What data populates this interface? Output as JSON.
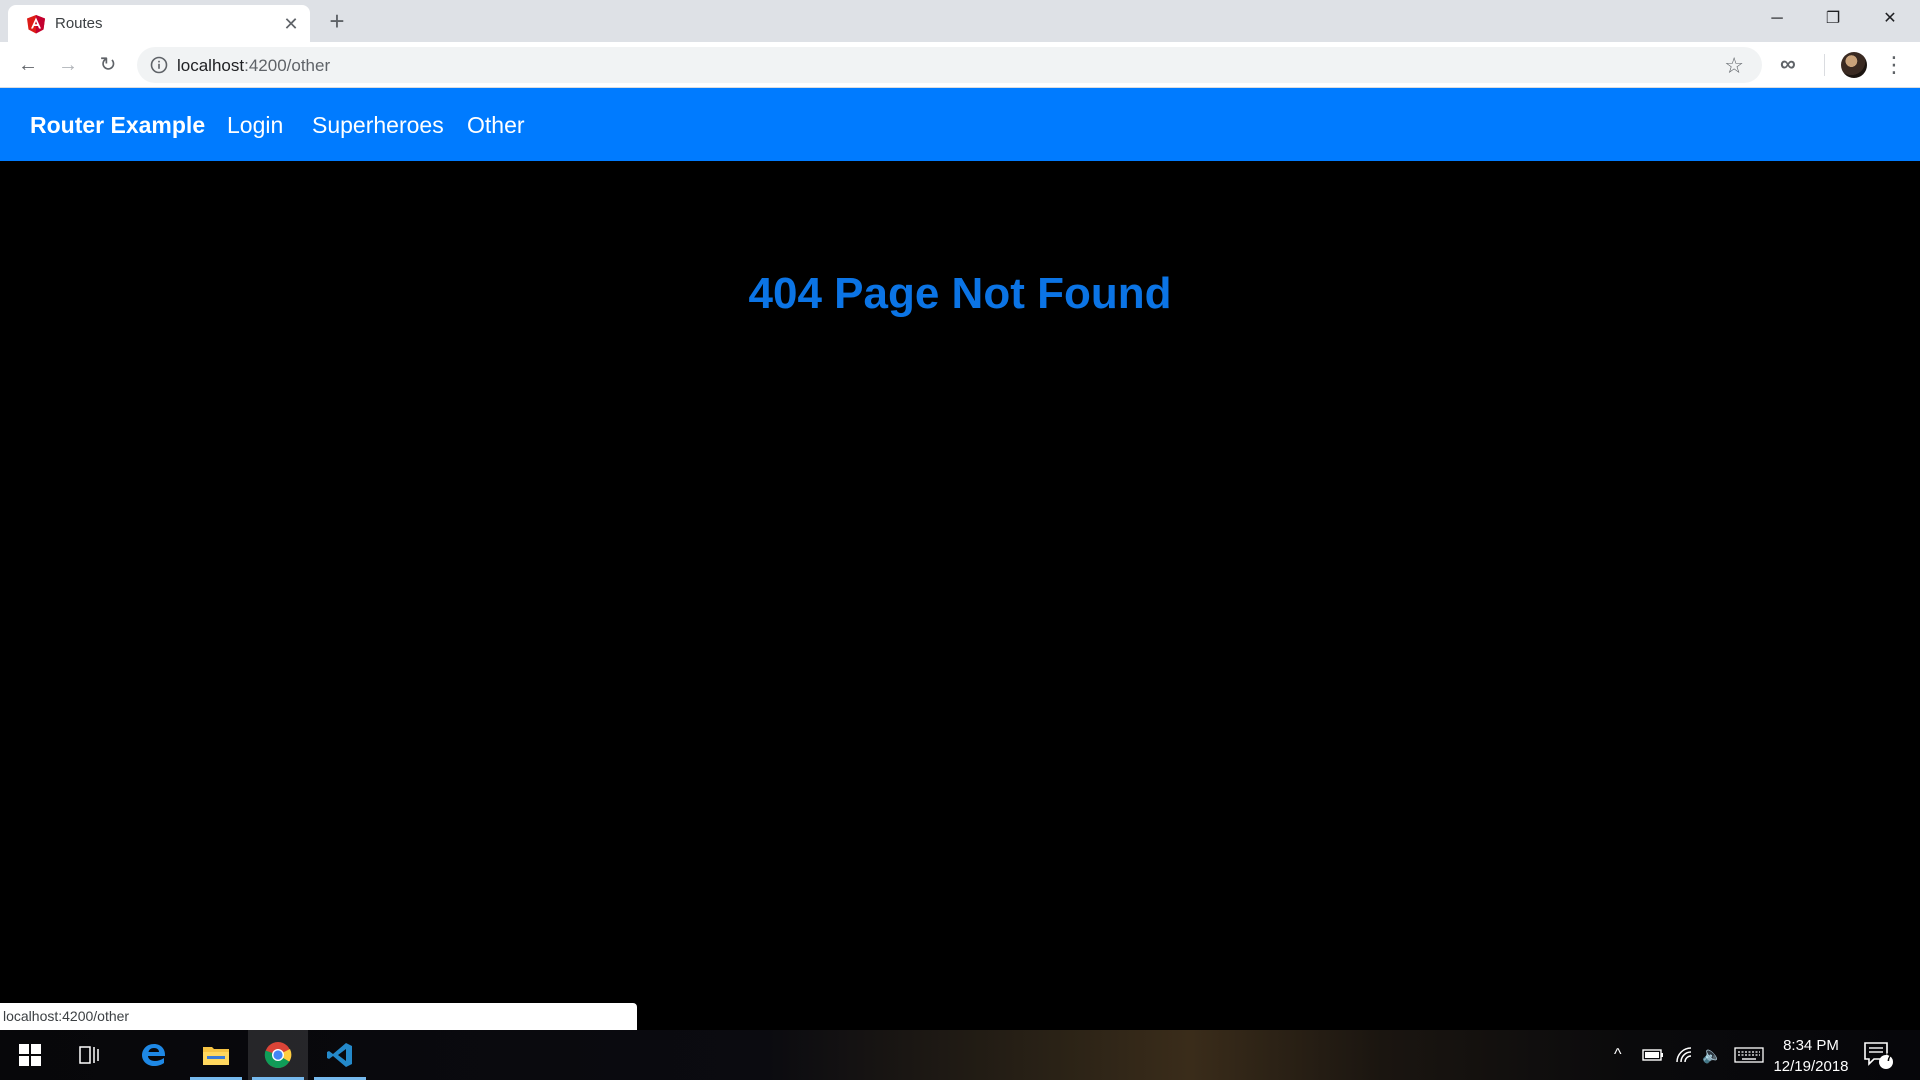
{
  "browser": {
    "tab_title": "Routes",
    "tab_close_glyph": "✕",
    "new_tab_glyph": "+",
    "url_host": "localhost",
    "url_path": ":4200/other",
    "status_url": "localhost:4200/other",
    "icons": {
      "favicon": "angular-icon",
      "back": "back-arrow-icon",
      "forward": "forward-arrow-icon",
      "reload": "reload-icon",
      "info": "info-icon",
      "bookmark": "star-icon",
      "extension": "infinity-icon",
      "menu": "kebab-menu-icon"
    },
    "glyphs": {
      "back": "←",
      "forward": "→",
      "reload": "↻",
      "star": "☆",
      "extension": "∞",
      "menu": "⋮",
      "minimize": "─",
      "maximize": "❐",
      "close": "✕"
    }
  },
  "app": {
    "brand": "Router Example",
    "nav": [
      {
        "label": "Login"
      },
      {
        "label": "Superheroes"
      },
      {
        "label": "Other"
      }
    ],
    "heading": "404 Page Not Found",
    "colors": {
      "navbar": "#007bff",
      "heading": "#0b74e5",
      "background": "#000000"
    }
  },
  "taskbar": {
    "time": "8:34 PM",
    "date": "12/19/2018",
    "notification_count": "7",
    "tray_glyphs": {
      "chevron": "^",
      "volume": "🔈"
    }
  }
}
